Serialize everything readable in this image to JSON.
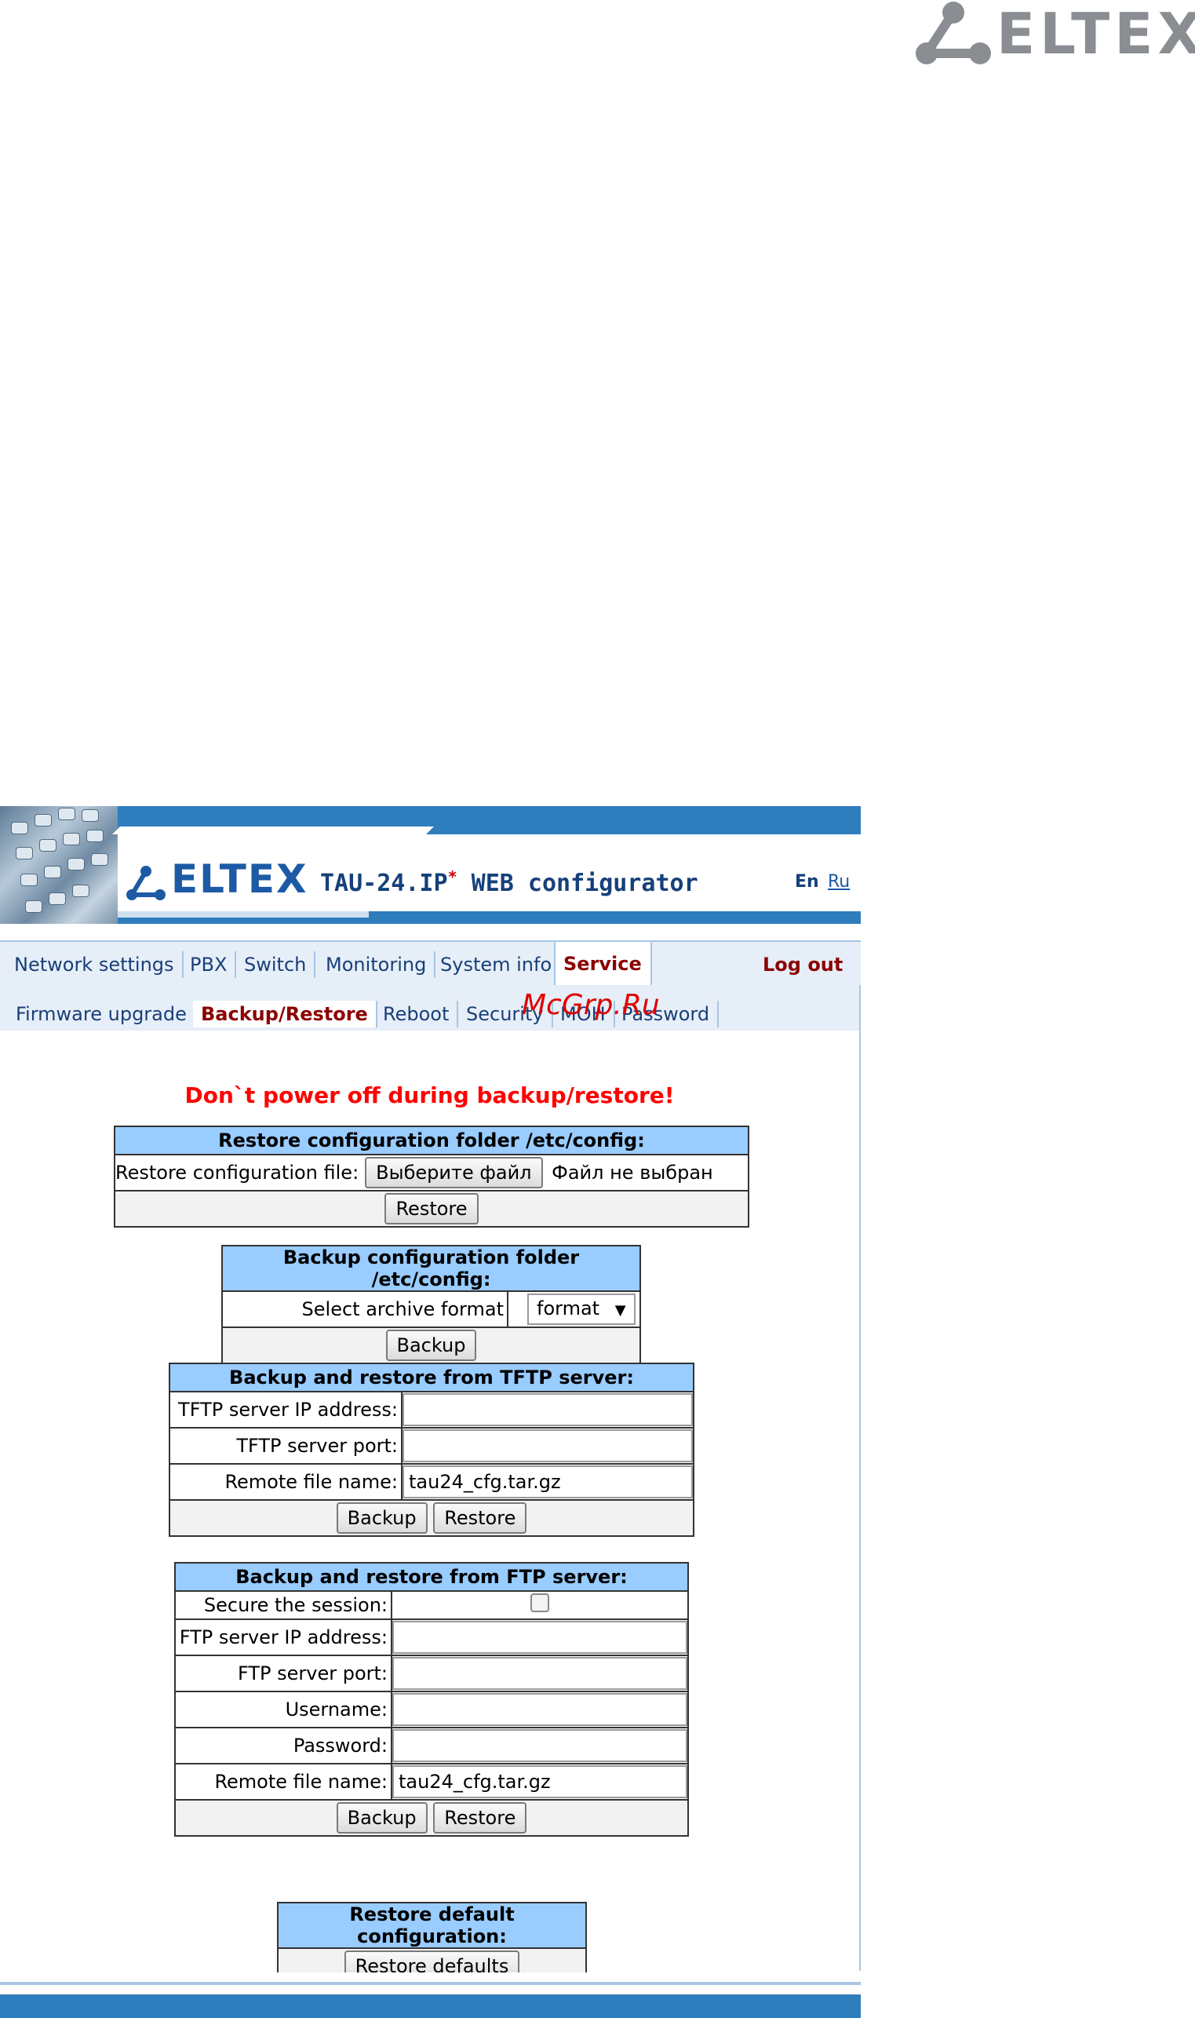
{
  "page_logo": {
    "text": "ELTEX"
  },
  "header": {
    "logo_text": "ELTEX",
    "title": "TAU-24.IP",
    "title_mark": "*",
    "title_suffix": "WEB configurator",
    "lang_en": "En",
    "lang_ru": "Ru"
  },
  "main_menu": {
    "items": [
      "Network settings",
      "PBX",
      "Switch",
      "Monitoring",
      "System info",
      "Service"
    ],
    "active": "Service",
    "logout": "Log out"
  },
  "sub_menu": {
    "items": [
      "Firmware upgrade",
      "Backup/Restore",
      "Reboot",
      "Security",
      "MOH",
      "Password"
    ],
    "active": "Backup/Restore"
  },
  "watermark": "McGrp.Ru",
  "warning": "Don`t power off during backup/restore!",
  "restore_section": {
    "title": "Restore configuration folder /etc/config:",
    "file_label": "Restore configuration file:",
    "choose_button": "Выберите файл",
    "no_file_text": "Файл не выбран",
    "restore_button": "Restore"
  },
  "backup_section": {
    "title": "Backup configuration folder /etc/config:",
    "format_label": "Select archive format",
    "format_value": "format",
    "backup_button": "Backup"
  },
  "tftp_section": {
    "title": "Backup and restore from TFTP server:",
    "ip_label": "TFTP server IP address:",
    "ip_value": "",
    "port_label": "TFTP server port:",
    "port_value": "",
    "file_label": "Remote file name:",
    "file_value": "tau24_cfg.tar.gz",
    "backup_button": "Backup",
    "restore_button": "Restore"
  },
  "ftp_section": {
    "title": "Backup and restore from FTP server:",
    "secure_label": "Secure the session:",
    "secure_checked": false,
    "ip_label": "FTP server IP address:",
    "ip_value": "",
    "port_label": "FTP server port:",
    "port_value": "",
    "user_label": "Username:",
    "user_value": "",
    "pass_label": "Password:",
    "pass_value": "",
    "file_label": "Remote file name:",
    "file_value": "tau24_cfg.tar.gz",
    "backup_button": "Backup",
    "restore_button": "Restore"
  },
  "defaults_section": {
    "title": "Restore default configuration:",
    "button": "Restore defaults"
  }
}
